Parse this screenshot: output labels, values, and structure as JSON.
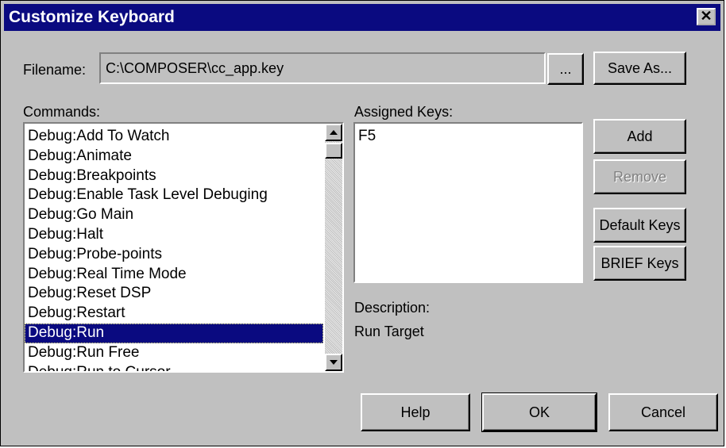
{
  "window": {
    "title": "Customize Keyboard",
    "close_label": "✕"
  },
  "filename": {
    "label": "Filename:",
    "value": "C:\\COMPOSER\\cc_app.key",
    "browse_label": "..."
  },
  "buttons": {
    "save_as": "Save As...",
    "add": "Add",
    "remove": "Remove",
    "default_keys": "Default Keys",
    "brief_keys": "BRIEF Keys",
    "help": "Help",
    "ok": "OK",
    "cancel": "Cancel"
  },
  "commands": {
    "label": "Commands:",
    "selected_index": 10,
    "items": [
      "Debug:Add To Watch",
      "Debug:Animate",
      "Debug:Breakpoints",
      "Debug:Enable Task Level Debuging",
      "Debug:Go Main",
      "Debug:Halt",
      "Debug:Probe-points",
      "Debug:Real Time Mode",
      "Debug:Reset DSP",
      "Debug:Restart",
      "Debug:Run",
      "Debug:Run Free",
      "Debug:Run to Cursor"
    ]
  },
  "assigned_keys": {
    "label": "Assigned Keys:",
    "items": [
      "F5"
    ]
  },
  "description": {
    "label": "Description:",
    "value": "Run Target"
  },
  "icons": {
    "scroll_up": "up-arrow-icon",
    "scroll_down": "down-arrow-icon",
    "close": "close-icon"
  }
}
